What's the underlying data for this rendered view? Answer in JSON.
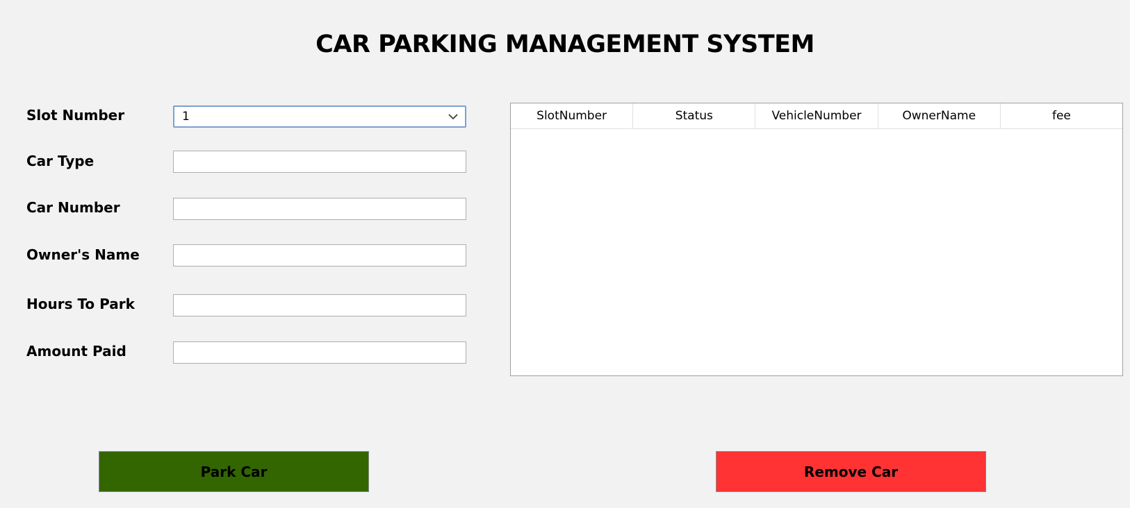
{
  "title": "CAR PARKING MANAGEMENT SYSTEM",
  "form": {
    "slot_number": {
      "label": "Slot Number",
      "value": "1"
    },
    "car_type": {
      "label": "Car Type",
      "value": ""
    },
    "car_number": {
      "label": "Car Number",
      "value": ""
    },
    "owner_name": {
      "label": "Owner's Name",
      "value": ""
    },
    "hours_to_park": {
      "label": "Hours To Park",
      "value": ""
    },
    "amount_paid": {
      "label": "Amount Paid",
      "value": ""
    }
  },
  "table": {
    "columns": [
      "SlotNumber",
      "Status",
      "VehicleNumber",
      "OwnerName",
      "fee"
    ],
    "rows": []
  },
  "buttons": {
    "park_label": "Park Car",
    "remove_label": "Remove Car"
  },
  "colors": {
    "park_button": "#336600",
    "remove_button": "#ff3333",
    "background": "#f2f2f2"
  },
  "icons": {
    "dropdown": "chevron-down-icon"
  }
}
